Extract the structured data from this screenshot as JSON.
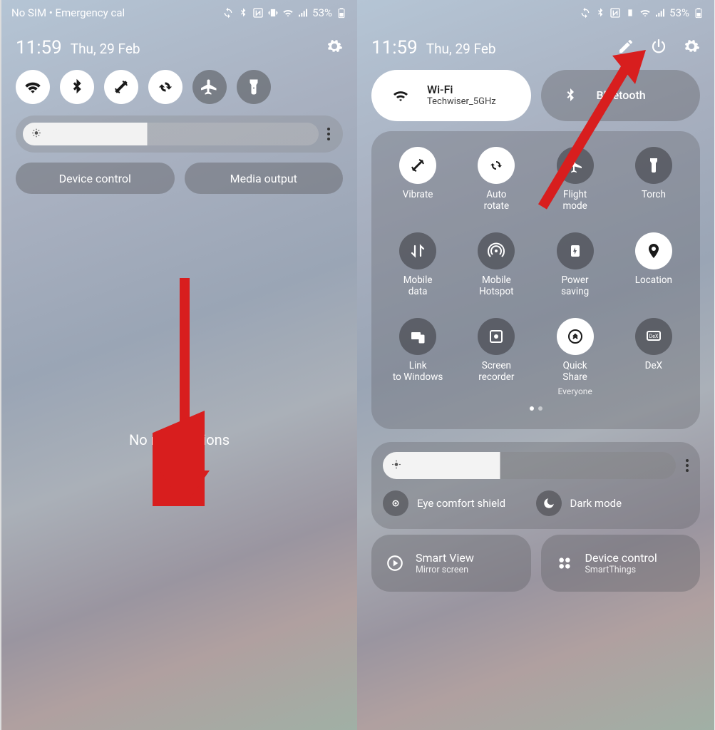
{
  "status": {
    "left_text": "No SIM • Emergency cal",
    "battery": "53%"
  },
  "datetime": {
    "time": "11:59",
    "date": "Thu, 29 Feb"
  },
  "panel1": {
    "device_control": "Device control",
    "media_output": "Media output",
    "no_notifications": "No notifications"
  },
  "panel2": {
    "wifi": {
      "title": "Wi-Fi",
      "sub": "Techwiser_5GHz"
    },
    "bluetooth": {
      "title": "Bluetooth"
    },
    "tiles": [
      {
        "label": "Vibrate",
        "on": true
      },
      {
        "label": "Auto rotate",
        "on": true
      },
      {
        "label": "Flight mode",
        "on": false
      },
      {
        "label": "Torch",
        "on": false
      },
      {
        "label": "Mobile data",
        "on": false
      },
      {
        "label": "Mobile Hotspot",
        "on": false
      },
      {
        "label": "Power saving",
        "on": false
      },
      {
        "label": "Location",
        "on": true
      },
      {
        "label": "Link to Windows",
        "on": false
      },
      {
        "label": "Screen recorder",
        "on": false
      },
      {
        "label": "Quick Share",
        "sub": "Everyone",
        "on": true
      },
      {
        "label": "DeX",
        "on": false
      }
    ],
    "eye_comfort": "Eye comfort shield",
    "dark_mode": "Dark mode",
    "smart_view": {
      "title": "Smart View",
      "sub": "Mirror screen"
    },
    "device_ctrl": {
      "title": "Device control",
      "sub": "SmartThings"
    }
  }
}
